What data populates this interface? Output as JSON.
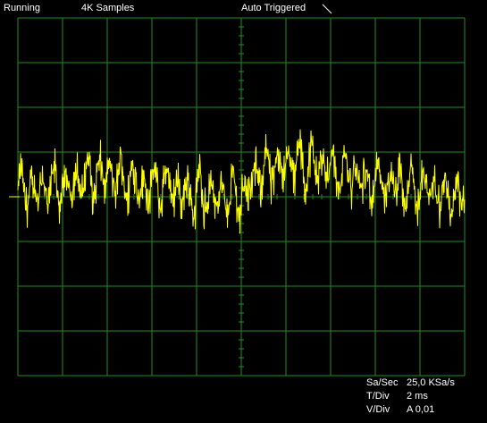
{
  "status": {
    "run_state": "Running",
    "samples": "4K Samples",
    "trigger_mode": "Auto Triggered",
    "trigger_slope_icon": "falling-slope-icon"
  },
  "readouts": {
    "sample_rate_label": "Sa/Sec",
    "sample_rate_value": "25,0 KSa/s",
    "time_div_label": "T/Div",
    "time_div_value": "2 ms",
    "volt_div_label": "V/Div",
    "volt_div_value": "A 0,01"
  },
  "colors": {
    "background": "#000000",
    "grid": "#1f8f1f",
    "trace": "#ffff00",
    "text": "#ffffff"
  },
  "chart_data": {
    "type": "line",
    "title": "",
    "xlabel": "",
    "ylabel": "",
    "grid": true,
    "divisions": {
      "x": 10,
      "y": 8
    },
    "x_unit": "div",
    "y_unit": "div",
    "xlim": [
      0,
      10
    ],
    "ylim": [
      -4,
      4
    ],
    "series": [
      {
        "envelope_x": [
          0,
          1,
          1.5,
          2,
          3,
          4,
          5,
          5.5,
          6,
          7,
          8,
          9,
          10
        ],
        "envelope_y": [
          0.1,
          0.2,
          0.4,
          0.5,
          0.25,
          0.05,
          0.05,
          0.6,
          0.75,
          0.65,
          0.3,
          0.15,
          0.0
        ],
        "noise_amplitude": 0.9,
        "oscillation_period_div": 0.25
      }
    ]
  }
}
